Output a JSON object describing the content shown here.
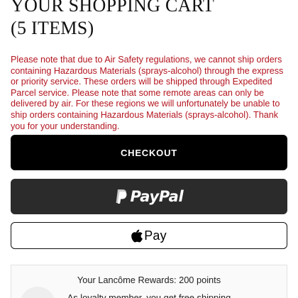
{
  "page": {
    "title_line1": "YOUR SHOPPING CART",
    "title_line2": "(5 ITEMS)"
  },
  "notice": {
    "text": "Please note that due to Air Safety regulations, we cannot ship orders containing Hazardous Materials (sprays-alcohol) through the express or priority service. These orders will be shipped through Expedited Parcel service. Please note that some remote areas can only be delivered by air. For these regions we will unfortunately be unable to ship orders containing Hazardous Materials (sprays-alcohol). Thank you for your understanding.",
    "color": "#b3151f"
  },
  "actions": {
    "checkout_label": "CHECKOUT",
    "paypal_label": "PayPal",
    "paypal_icon": "paypal-icon",
    "applepay_label": "Pay",
    "applepay_icon": "apple-icon"
  },
  "rewards": {
    "points_text": "Your Lancôme Rewards: 200 points",
    "shipping_text": "As loyalty member, you get free shipping"
  }
}
